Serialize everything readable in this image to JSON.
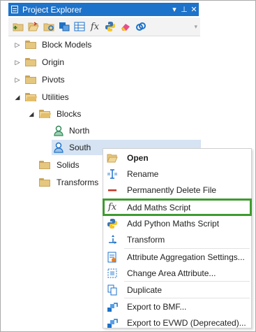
{
  "panel": {
    "title": "Project Explorer",
    "buttons": {
      "dropdown": "▾",
      "pin": "⊥",
      "close": "✕"
    }
  },
  "toolbar": {
    "icons": [
      "new-folder-icon",
      "open-folder-icon",
      "folder-refresh-icon",
      "blocks-icon",
      "grid-icon",
      "fx-icon",
      "python-icon",
      "eraser-icon",
      "link-icon"
    ],
    "fx_glyph": "fx",
    "more": "▾"
  },
  "tree": {
    "items": [
      {
        "label": "Block Models",
        "level": 0,
        "expander": "▷",
        "kind": "folder",
        "expanded": false
      },
      {
        "label": "Origin",
        "level": 0,
        "expander": "▷",
        "kind": "folder",
        "expanded": false
      },
      {
        "label": "Pivots",
        "level": 0,
        "expander": "▷",
        "kind": "folder",
        "expanded": false
      },
      {
        "label": "Utilities",
        "level": 0,
        "expander": "◢",
        "kind": "folder",
        "expanded": true
      },
      {
        "label": "Blocks",
        "level": 1,
        "expander": "◢",
        "kind": "folder",
        "expanded": true
      },
      {
        "label": "North",
        "level": 2,
        "expander": "",
        "kind": "item",
        "expanded": false
      },
      {
        "label": "South",
        "level": 2,
        "expander": "",
        "kind": "item",
        "expanded": false,
        "selected": true
      },
      {
        "label": "Solids",
        "level": 1,
        "expander": "",
        "kind": "folder",
        "expanded": false
      },
      {
        "label": "Transforms",
        "level": 1,
        "expander": "",
        "kind": "folder",
        "expanded": false
      }
    ]
  },
  "context_menu": {
    "items": [
      {
        "label": "Open",
        "icon": "open-folder-icon",
        "bold": true
      },
      {
        "label": "Rename",
        "icon": "rename-icon"
      },
      {
        "label": "Permanently Delete File",
        "icon": "delete-icon"
      },
      {
        "label": "Add Maths Script",
        "icon": "fx-icon",
        "highlighted": true
      },
      {
        "label": "Add Python Maths Script",
        "icon": "python-icon"
      },
      {
        "label": "Transform",
        "icon": "transform-icon"
      },
      {
        "label": "Attribute Aggregation Settings...",
        "icon": "aggregation-icon"
      },
      {
        "label": "Change Area Attribute...",
        "icon": "area-attribute-icon"
      },
      {
        "label": "Duplicate",
        "icon": "duplicate-icon"
      },
      {
        "label": "Export to BMF...",
        "icon": "export-bmf-icon"
      },
      {
        "label": "Export to EVWD (Deprecated)...",
        "icon": "export-evwd-icon"
      }
    ],
    "highlight_color": "#3f9a2f"
  },
  "colors": {
    "titlebar": "#1d72c9",
    "selection": "#d5e3f3",
    "folder": "#e5c77f"
  }
}
